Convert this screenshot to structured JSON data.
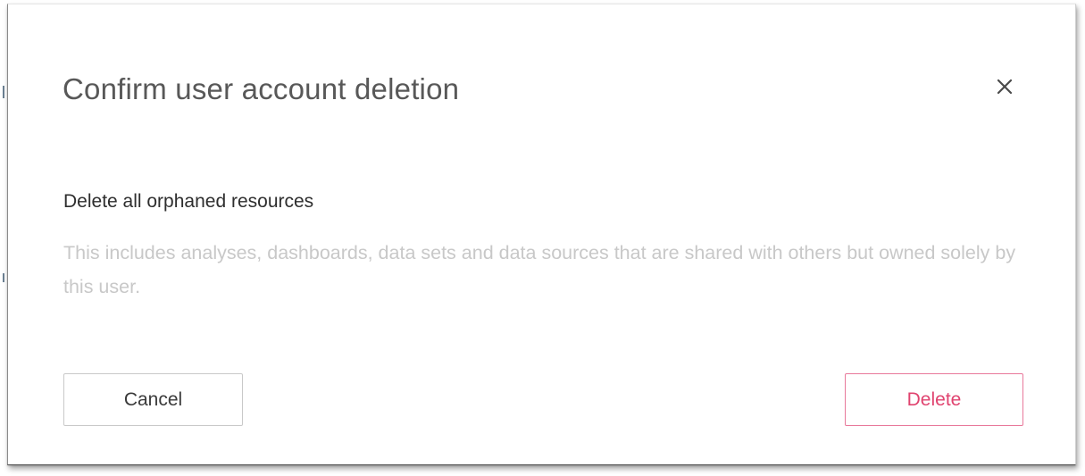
{
  "dialog": {
    "title": "Confirm user account deletion",
    "close_icon": "close-icon",
    "option": {
      "heading": "Delete all orphaned resources",
      "description": "This includes analyses, dashboards, data sets and data sources that are shared with others but owned solely by this user."
    },
    "buttons": {
      "cancel_label": "Cancel",
      "delete_label": "Delete"
    }
  },
  "colors": {
    "title_text": "#585858",
    "description_text": "#c8c8c8",
    "delete_accent": "#e0436f",
    "delete_border": "#e8789a",
    "cancel_border": "#c9c9c9"
  }
}
